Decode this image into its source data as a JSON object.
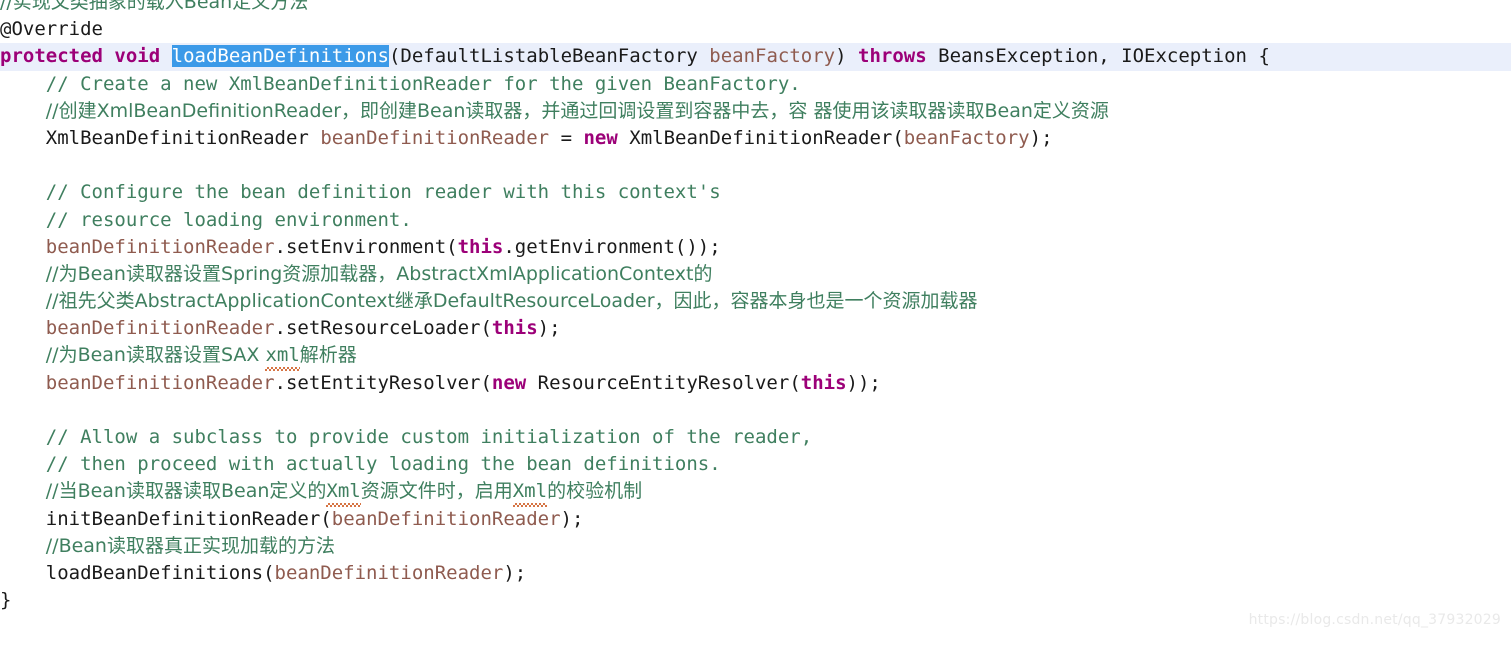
{
  "editor": {
    "language": "java",
    "font_size_px": 19,
    "line_height_px": 27.2,
    "background": "#ffffff",
    "current_line_highlight": "#eaeffb",
    "selection_background": "#3c9ae8",
    "selection_foreground": "#ffffff",
    "colors": {
      "keyword": "#9c0078",
      "comment": "#3f7f5f",
      "variable": "#8f5b4f",
      "plain": "#1a1a1a",
      "squiggly_underline": "#d0622a",
      "watermark": "#e9e9e9"
    }
  },
  "lines": {
    "l00_clipped": "//",
    "l01_comment": "//实现父类抽象的载入Bean定义方法",
    "l02_annotation": "@Override",
    "l03": {
      "kw_protected": "protected",
      "kw_void": "void",
      "selected_method": "loadBeanDefinitions",
      "paren_open": "(",
      "param_type": "DefaultListableBeanFactory",
      "param_name": "beanFactory",
      "paren_close": ")",
      "kw_throws": "throws",
      "exceptions": "BeansException, IOException",
      "brace_open": "{"
    },
    "l04_comment": "// Create a new XmlBeanDefinitionReader for the given BeanFactory.",
    "l05_comment": "//创建XmlBeanDefinitionReader，即创建Bean读取器，并通过回调设置到容器中去，容 器使用该读取器读取Bean定义资源",
    "l06": {
      "type": "XmlBeanDefinitionReader",
      "var": "beanDefinitionReader",
      "eq": "=",
      "kw_new": "new",
      "ctor": "XmlBeanDefinitionReader(",
      "arg": "beanFactory",
      "tail": ");"
    },
    "l07_blank": "",
    "l08_comment": "// Configure the bean definition reader with this context's",
    "l09_comment": "// resource loading environment.",
    "l10": {
      "var": "beanDefinitionReader",
      "dot_method": ".setEnvironment(",
      "kw_this": "this",
      "tail": ".getEnvironment());"
    },
    "l11_comment": "//为Bean读取器设置Spring资源加载器，AbstractXmlApplicationContext的",
    "l12_comment": "//祖先父类AbstractApplicationContext继承DefaultResourceLoader，因此，容器本身也是一个资源加载器",
    "l13": {
      "var": "beanDefinitionReader",
      "dot_method": ".setResourceLoader(",
      "kw_this": "this",
      "tail": ");"
    },
    "l14_comment_a": "//为Bean读取器设置SAX ",
    "l14_comment_misspelled": "xml",
    "l14_comment_b": "解析器",
    "l15": {
      "var": "beanDefinitionReader",
      "dot_method": ".setEntityResolver(",
      "kw_new": "new",
      "ctor": " ResourceEntityResolver(",
      "kw_this": "this",
      "tail": "));"
    },
    "l16_blank": "",
    "l17_comment": "// Allow a subclass to provide custom initialization of the reader,",
    "l18_comment": "// then proceed with actually loading the bean definitions.",
    "l19_comment_a": "//当Bean读取器读取Bean定义的",
    "l19_comment_misspelled_1": "Xml",
    "l19_comment_b": "资源文件时，启用",
    "l19_comment_misspelled_2": "Xml",
    "l19_comment_c": "的校验机制",
    "l20": {
      "method": "initBeanDefinitionReader(",
      "arg": "beanDefinitionReader",
      "tail": ");"
    },
    "l21_comment": "//Bean读取器真正实现加载的方法",
    "l22": {
      "method": "loadBeanDefinitions(",
      "arg": "beanDefinitionReader",
      "tail": ");"
    },
    "l23_brace_close": "}"
  },
  "watermark": {
    "text": "https://blog.csdn.net/qq_37932029"
  }
}
